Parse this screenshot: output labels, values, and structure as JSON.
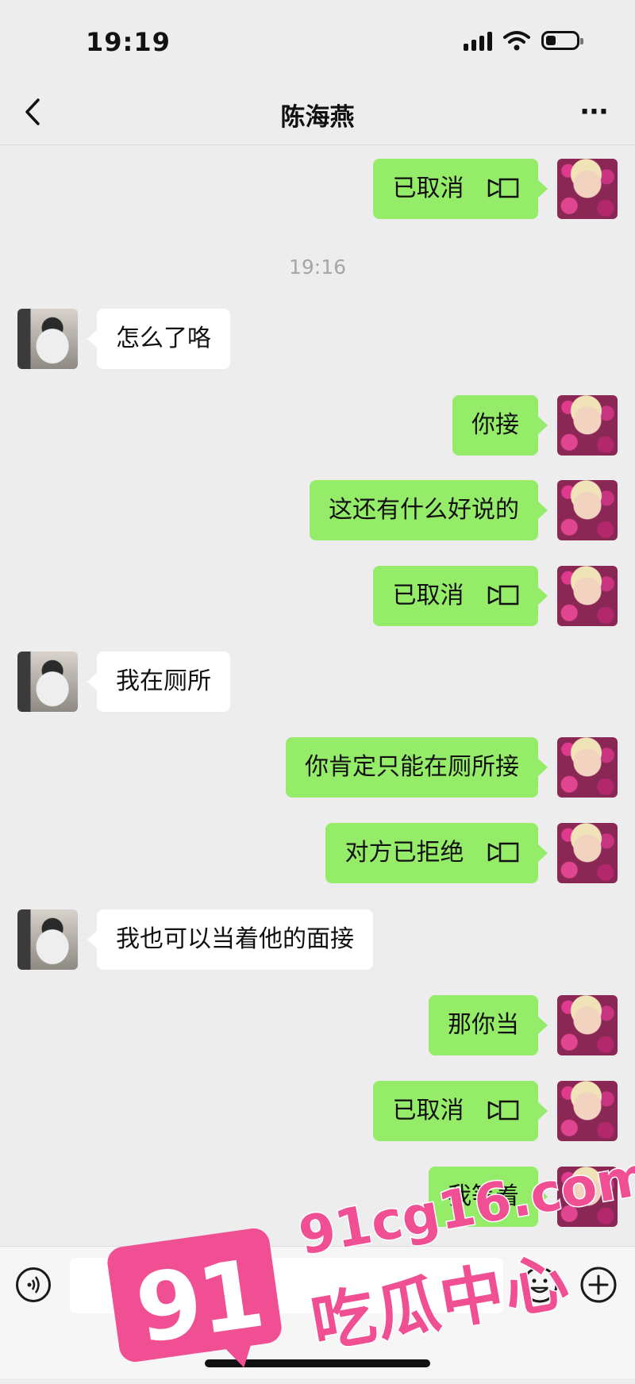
{
  "status_bar": {
    "time": "19:19"
  },
  "header": {
    "title": "陈海燕"
  },
  "timestamp": "19:16",
  "messages": [
    {
      "side": "me",
      "text": "已取消",
      "video": true
    },
    {
      "side": "other",
      "text": "怎么了咯"
    },
    {
      "side": "me",
      "text": "你接"
    },
    {
      "side": "me",
      "text": "这还有什么好说的"
    },
    {
      "side": "me",
      "text": "已取消",
      "video": true
    },
    {
      "side": "other",
      "text": "我在厕所"
    },
    {
      "side": "me",
      "text": "你肯定只能在厕所接"
    },
    {
      "side": "me",
      "text": "对方已拒绝",
      "video": true
    },
    {
      "side": "other",
      "text": "我也可以当着他的面接"
    },
    {
      "side": "me",
      "text": "那你当"
    },
    {
      "side": "me",
      "text": "已取消",
      "video": true
    },
    {
      "side": "me",
      "text": "我等着"
    }
  ],
  "watermark": {
    "number": "91",
    "site": "91cg16.com",
    "name": "吃瓜中心"
  },
  "colors": {
    "my_bubble": "#95ec69",
    "their_bubble": "#ffffff",
    "background": "#ededed",
    "watermark": "#f04f94"
  }
}
